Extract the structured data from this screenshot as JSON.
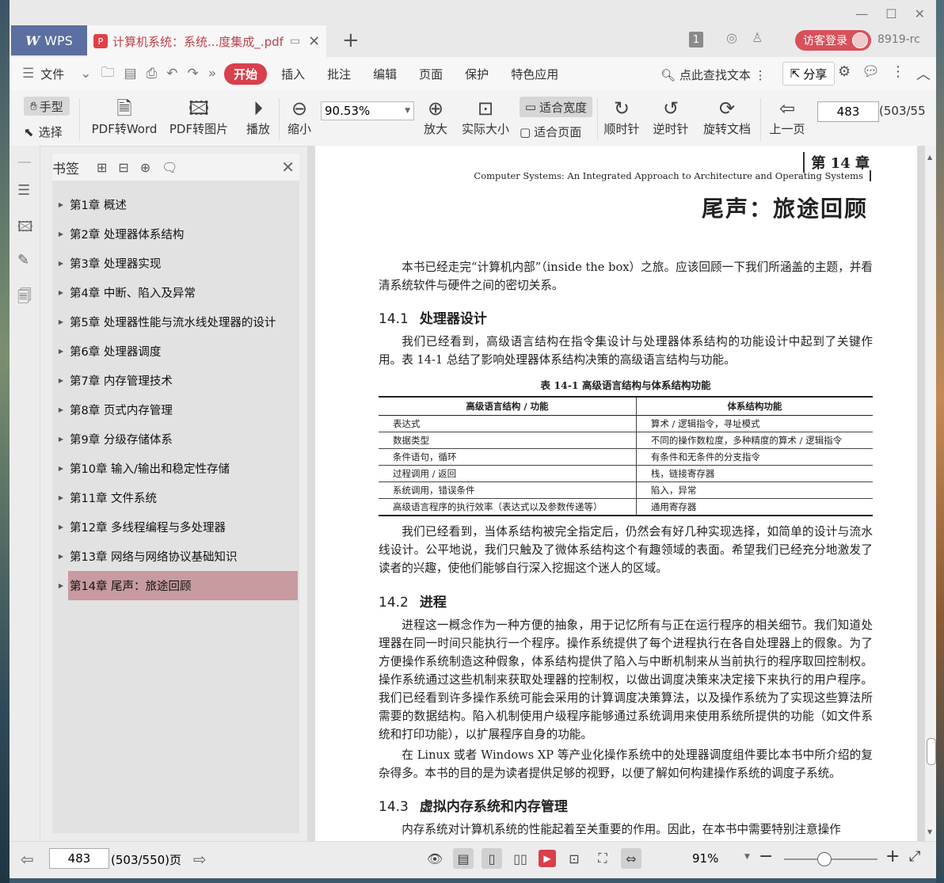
{
  "titlebar": {
    "app_name": "WPS",
    "doc_tab": "计算机系统：系统...度集成_.pdf",
    "page_badge": "1",
    "login_label": "访客登录",
    "user_id": "8919-rc"
  },
  "menubar": {
    "file_label": "文件",
    "tabs": [
      "开始",
      "插入",
      "批注",
      "编辑",
      "页面",
      "保护",
      "特色应用"
    ],
    "search_label": "点此查找文本",
    "share_label": "分享"
  },
  "toolbar": {
    "hand_label": "手型",
    "select_label": "选择",
    "pdf_to_word": "PDF转Word",
    "pdf_to_image": "PDF转图片",
    "play": "播放",
    "zoom_out": "缩小",
    "zoom_value": "90.53%",
    "zoom_in": "放大",
    "actual_size": "实际大小",
    "fit_width": "适合宽度",
    "fit_page": "适合页面",
    "rotate_cw": "顺时针",
    "rotate_ccw": "逆时针",
    "rotate_doc": "旋转文档",
    "prev_page": "上一页",
    "page_input": "483",
    "page_total": "(503/55"
  },
  "bookmarks": {
    "title": "书签",
    "items": [
      "第1章  概述",
      "第2章  处理器体系结构",
      "第3章  处理器实现",
      "第4章  中断、陷入及异常",
      "第5章  处理器性能与流水线处理器的设计",
      "第6章  处理器调度",
      "第7章  内存管理技术",
      "第8章  页式内存管理",
      "第9章  分级存储体系",
      "第10章  输入/输出和稳定性存储",
      "第11章  文件系统",
      "第12章  多线程编程与多处理器",
      "第13章  网络与网络协议基础知识",
      "第14章  尾声：旅途回顾"
    ],
    "selected_index": 13
  },
  "page": {
    "chapter_num": "第 14 章",
    "chapter_en": "Computer Systems: An Integrated Approach to Architecture and Operating Systems",
    "chapter_title": "尾声：旅途回顾",
    "intro": "本书已经走完“计算机内部”（inside the box）之旅。应该回顾一下我们所涵盖的主题，并看清系统软件与硬件之间的密切关系。",
    "s1_num": "14.1",
    "s1_title": "处理器设计",
    "s1_p1": "我们已经看到，高级语言结构在指令集设计与处理器体系结构的功能设计中起到了关键作用。表 14-1 总结了影响处理器体系结构决策的高级语言结构与功能。",
    "table_caption": "表 14-1    高级语言结构与体系结构功能",
    "table_headers": [
      "高级语言结构 / 功能",
      "体系结构功能"
    ],
    "table_rows": [
      [
        "表达式",
        "算术 / 逻辑指令，寻址模式"
      ],
      [
        "数据类型",
        "不同的操作数粒度，多种精度的算术 / 逻辑指令"
      ],
      [
        "条件语句，循环",
        "有条件和无条件的分支指令"
      ],
      [
        "过程调用 / 返回",
        "栈，链接寄存器"
      ],
      [
        "系统调用，错误条件",
        "陷入，异常"
      ],
      [
        "高级语言程序的执行效率（表达式以及参数传递等）",
        "通用寄存器"
      ]
    ],
    "s1_p2": "我们已经看到，当体系结构被完全指定后，仍然会有好几种实现选择，如简单的设计与流水线设计。公平地说，我们只触及了微体系结构这个有趣领域的表面。希望我们已经充分地激发了读者的兴趣，使他们能够自行深入挖掘这个迷人的区域。",
    "s2_num": "14.2",
    "s2_title": "进程",
    "s2_p1": "进程这一概念作为一种方便的抽象，用于记忆所有与正在运行程序的相关细节。我们知道处理器在同一时间只能执行一个程序。操作系统提供了每个进程执行在各自处理器上的假象。为了方便操作系统制造这种假象，体系结构提供了陷入与中断机制来从当前执行的程序取回控制权。操作系统通过这些机制来获取处理器的控制权，以做出调度决策来决定接下来执行的用户程序。我们已经看到许多操作系统可能会采用的计算调度决策算法，以及操作系统为了实现这些算法所需要的数据结构。陷入机制使用户级程序能够通过系统调用来使用系统所提供的功能（如文件系统和打印功能），以扩展程序自身的功能。",
    "s2_p2": "在 Linux 或者 Windows XP 等产业化操作系统中的处理器调度组件要比本书中所介绍的复杂得多。本书的目的是为读者提供足够的视野，以便了解如何构建操作系统的调度子系统。",
    "s3_num": "14.3",
    "s3_title": "虚拟内存系统和内存管理",
    "s3_p1": "内存系统对计算机系统的性能起着至关重要的作用。因此，在本书中需要特别注意操作"
  },
  "statusbar": {
    "page_input": "483",
    "page_total": "(503/550)页",
    "zoom": "91%"
  }
}
